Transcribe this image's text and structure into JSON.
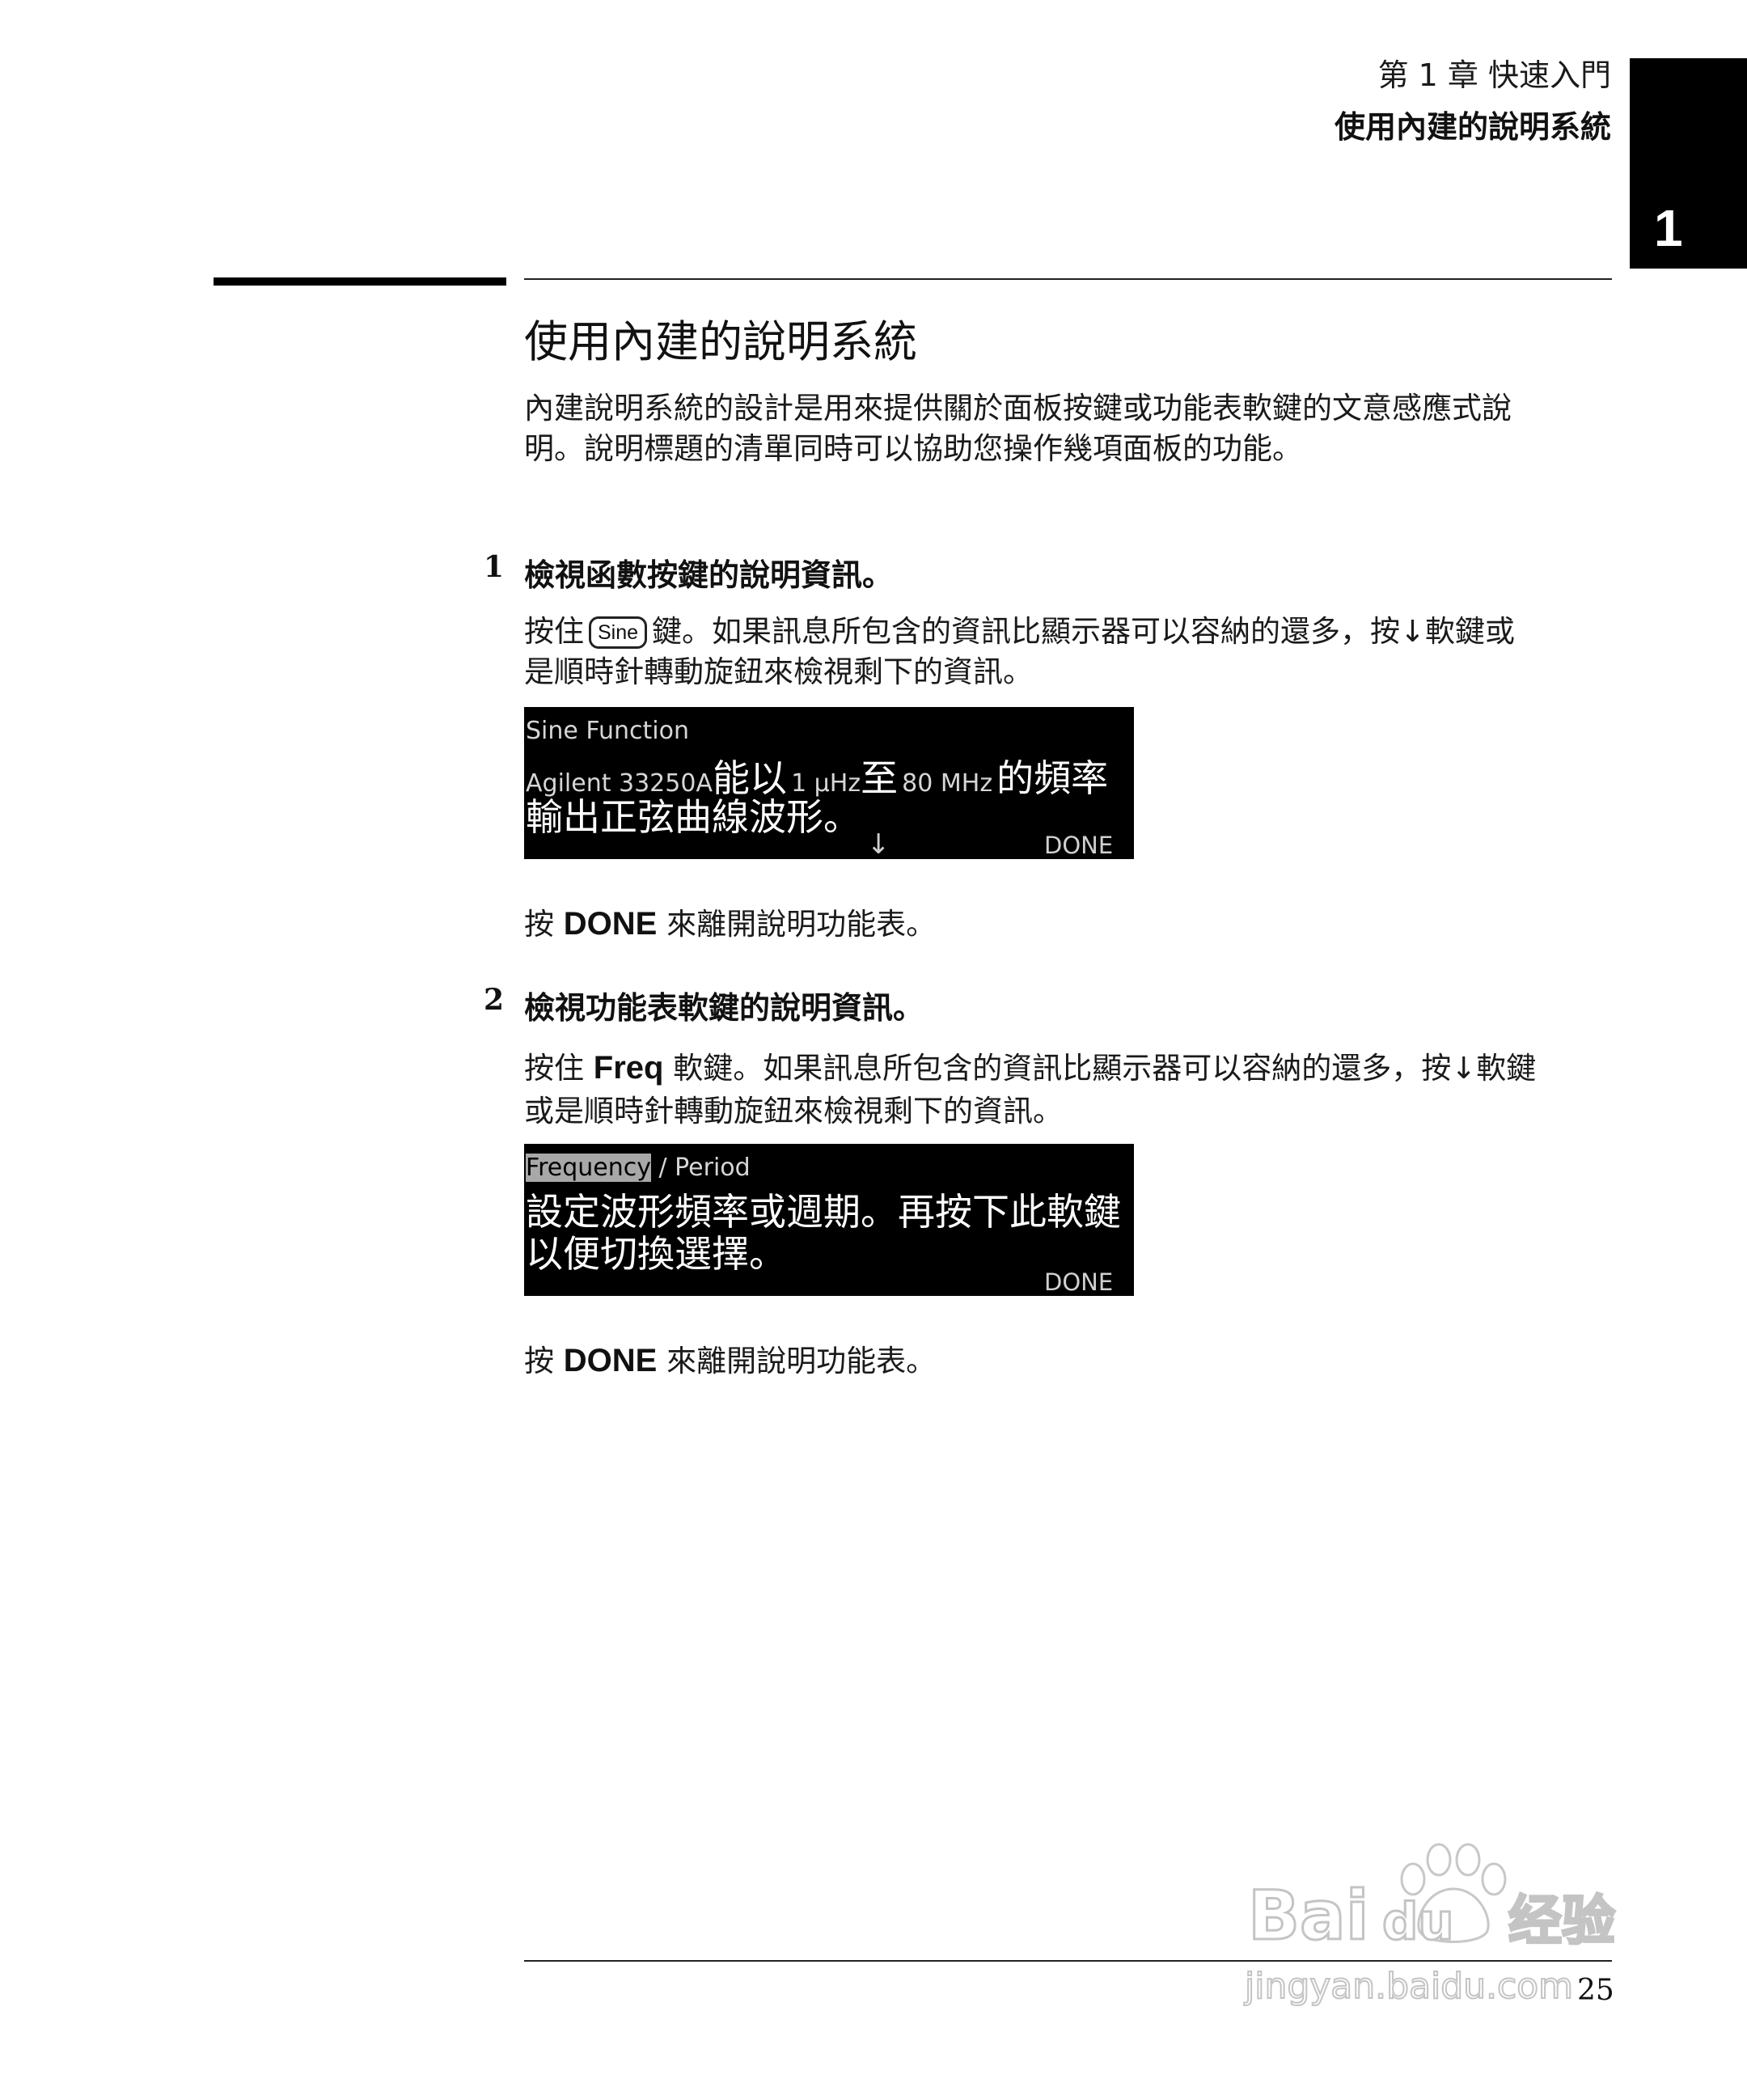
{
  "header": {
    "chapter": "第 1 章 快速入門",
    "section": "使用內建的說明系統",
    "chapter_tab": "1"
  },
  "page": {
    "title": "使用內建的說明系統",
    "intro_line1": "內建說明系統的設計是用來提供關於面板按鍵或功能表軟鍵的文意感應式說",
    "intro_line2": "明。說明標題的清單同時可以協助您操作幾項面板的功能。"
  },
  "steps": [
    {
      "number": "1",
      "title": "檢視函數按鍵的說明資訊。",
      "line1_prefix": "按住",
      "key_label": "Sine",
      "line1_suffix": "鍵。如果訊息所包含的資訊比顯示器可以容納的還多，按↓軟鍵或",
      "line2": "是順時針轉動旋鈕來檢視剩下的資訊。",
      "display": {
        "header": "Sine Function",
        "row1_a": "Agilent 33250A",
        "row1_b": "能以",
        "row1_c": "1 µHz",
        "row1_d": "至",
        "row1_e": "80 MHz",
        "row1_f": "的頻率",
        "row2": "輸出正弦曲線波形。",
        "arrow": "↓",
        "softkey": "DONE"
      },
      "done_prefix": "按",
      "done_key": "DONE",
      "done_suffix": "來離開說明功能表。"
    },
    {
      "number": "2",
      "title": "檢視功能表軟鍵的說明資訊。",
      "line1_prefix": "按住",
      "key_label": "Freq",
      "line1_suffix": "軟鍵。如果訊息所包含的資訊比顯示器可以容納的還多，按↓軟鍵",
      "line2": "或是順時針轉動旋鈕來檢視剩下的資訊。",
      "display": {
        "header_hl": "Frequency",
        "header_rest": " / Period",
        "row1": "設定波形頻率或週期。再按下此軟鍵",
        "row2": "以便切換選擇。",
        "softkey": "DONE"
      },
      "done_prefix": "按",
      "done_key": "DONE",
      "done_suffix": "來離開說明功能表。"
    }
  ],
  "footer": {
    "page_number": "25"
  },
  "watermark": {
    "text": "Bai du 经验",
    "url_text": "jingyan.baidu.com"
  }
}
